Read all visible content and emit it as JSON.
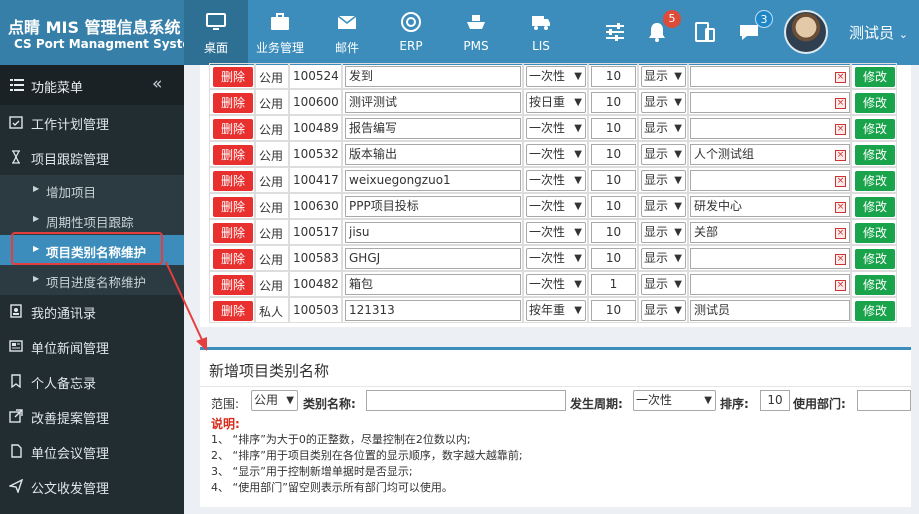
{
  "brand": {
    "title": "点睛 MIS 管理信息系统",
    "subtitle": "CS Port Managment System"
  },
  "nav": [
    {
      "label": "桌面",
      "icon": "monitor-icon"
    },
    {
      "label": "业务管理",
      "icon": "briefcase-icon"
    },
    {
      "label": "邮件",
      "icon": "mail-icon"
    },
    {
      "label": "ERP",
      "icon": "chrome-icon"
    },
    {
      "label": "PMS",
      "icon": "ship-icon"
    },
    {
      "label": "LIS",
      "icon": "truck-icon"
    }
  ],
  "header": {
    "notifications_count": "5",
    "messages_count": "3",
    "username": "测试员"
  },
  "sidebar": {
    "menu_title": "功能菜单",
    "items": [
      {
        "label": "工作计划管理"
      },
      {
        "label": "项目跟踪管理"
      },
      {
        "label": "我的通讯录"
      },
      {
        "label": "单位新闻管理"
      },
      {
        "label": "个人备忘录"
      },
      {
        "label": "改善提案管理"
      },
      {
        "label": "单位会议管理"
      },
      {
        "label": "公文收发管理"
      }
    ],
    "sub_items": [
      {
        "label": "增加项目"
      },
      {
        "label": "周期性项目跟踪"
      },
      {
        "label": "项目类别名称维护"
      },
      {
        "label": "项目进度名称维护"
      }
    ]
  },
  "table": {
    "delete_label": "删除",
    "modify_label": "修改",
    "rows": [
      {
        "scope": "公用",
        "id": "100524",
        "name": "发到",
        "cycle": "一次性",
        "order": "10",
        "display": "显示",
        "dept": ""
      },
      {
        "scope": "公用",
        "id": "100600",
        "name": "测评测试",
        "cycle": "按日重",
        "order": "10",
        "display": "显示",
        "dept": ""
      },
      {
        "scope": "公用",
        "id": "100489",
        "name": "报告编写",
        "cycle": "一次性",
        "order": "10",
        "display": "显示",
        "dept": ""
      },
      {
        "scope": "公用",
        "id": "100532",
        "name": "版本输出",
        "cycle": "一次性",
        "order": "10",
        "display": "显示",
        "dept": "人个测试组"
      },
      {
        "scope": "公用",
        "id": "100417",
        "name": "weixuegongzuo1",
        "cycle": "一次性",
        "order": "10",
        "display": "显示",
        "dept": ""
      },
      {
        "scope": "公用",
        "id": "100630",
        "name": "PPP项目投标",
        "cycle": "一次性",
        "order": "10",
        "display": "显示",
        "dept": "研发中心"
      },
      {
        "scope": "公用",
        "id": "100517",
        "name": "jisu",
        "cycle": "一次性",
        "order": "10",
        "display": "显示",
        "dept": "关部"
      },
      {
        "scope": "公用",
        "id": "100583",
        "name": "GHGJ",
        "cycle": "一次性",
        "order": "10",
        "display": "显示",
        "dept": ""
      },
      {
        "scope": "公用",
        "id": "100482",
        "name": "箱包",
        "cycle": "一次性",
        "order": "1",
        "display": "显示",
        "dept": ""
      },
      {
        "scope": "私人",
        "id": "100503",
        "name": "121313",
        "cycle": "按年重",
        "order": "10",
        "display": "显示",
        "dept": "测试员"
      }
    ]
  },
  "add_form": {
    "title": "新增项目类别名称",
    "scope_label": "范围:",
    "scope_value": "公用",
    "name_label": "类别名称:",
    "name_value": "",
    "cycle_label": "发生周期:",
    "cycle_value": "一次性",
    "order_label": "排序:",
    "order_value": "10",
    "dept_label": "使用部门:",
    "dept_value": "",
    "note_title": "说明:",
    "notes": [
      "1、 “排序”为大于0的正整数，尽量控制在2位数以内;",
      "2、 “排序”用于项目类别在各位置的显示顺序，数字越大越靠前;",
      "3、 “显示”用于控制新增单据时是否显示;",
      "4、 “使用部门”留空则表示所有部门均可以使用。"
    ]
  },
  "colors": {
    "header": "#3c8dbc",
    "sidebar": "#222d32",
    "delete": "#e8312f",
    "modify": "#19a34b",
    "highlight": "#e53e3e"
  }
}
